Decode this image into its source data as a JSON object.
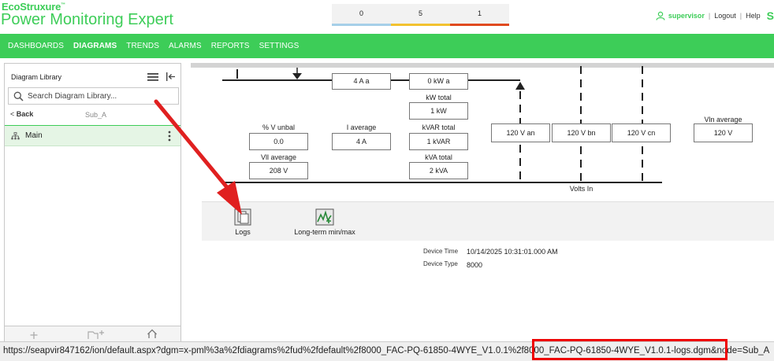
{
  "header": {
    "brand_top": "EcoStruxure",
    "brand_name": "Power Monitoring Expert",
    "alarms": [
      {
        "count": "0",
        "color": "#a6cfe8"
      },
      {
        "count": "5",
        "color": "#f2c230"
      },
      {
        "count": "1",
        "color": "#e04a1f"
      }
    ],
    "user": "supervisor",
    "logout": "Logout",
    "help": "Help",
    "logo_letter": "S"
  },
  "nav": {
    "items": [
      "DASHBOARDS",
      "DIAGRAMS",
      "TRENDS",
      "ALARMS",
      "REPORTS",
      "SETTINGS"
    ],
    "active": "DIAGRAMS"
  },
  "library": {
    "title": "Diagram Library",
    "search_placeholder": "Search Diagram Library...",
    "back": "Back",
    "breadcrumb": "Sub_A",
    "selected_item": "Main"
  },
  "diagram": {
    "top_values": {
      "current_a": "4 A a",
      "kw_a": "0 kW a"
    },
    "kw_total": {
      "label": "kW total",
      "value": "1 kW"
    },
    "kvar_total": {
      "label": "kVAR total",
      "value": "1 kVAR"
    },
    "kva_total": {
      "label": "kVA total",
      "value": "2 kVA"
    },
    "v_unbal": {
      "label": "% V unbal",
      "value": "0.0"
    },
    "vll_average": {
      "label": "Vll average",
      "value": "208 V"
    },
    "i_average": {
      "label": "I average",
      "value": "4 A"
    },
    "v_an": "120 V an",
    "v_bn": "120 V bn",
    "v_cn": "120 V cn",
    "vln_average": {
      "label": "Vln average",
      "value": "120 V"
    },
    "volts_in": "Volts In"
  },
  "links": {
    "logs": "Logs",
    "longterm": "Long-term min/max"
  },
  "device": {
    "time_label": "Device Time",
    "time_value": "10/14/2025 10:31:01.000 AM",
    "type_label": "Device Type",
    "type_value": "8000"
  },
  "status_url": "https://seapvir847162/ion/default.aspx?dgm=x-pml%3a%2fdiagrams%2fud%2fdefault%2f8000_FAC-PQ-61850-4WYE_V1.0.1%2f8000_FAC-PQ-61850-4WYE_V1.0.1-logs.dgm&node=Sub_A"
}
